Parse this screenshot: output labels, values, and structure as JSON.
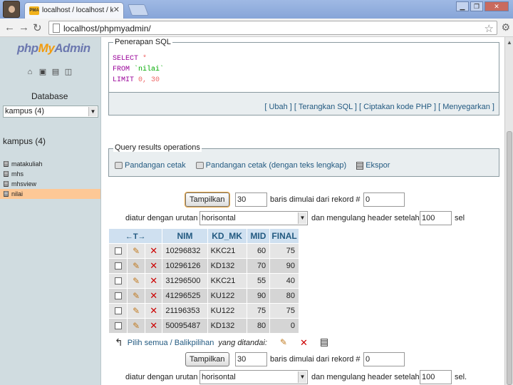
{
  "browser": {
    "tab_title": "localhost / localhost / kampus",
    "tab_favicon": "PMA",
    "tab_close": "✕",
    "url": "localhost/phpmyadmin/"
  },
  "sidebar": {
    "logo_php": "php",
    "logo_my": "My",
    "logo_admin": "Admin",
    "database_label": "Database",
    "database_select": "kampus (4)",
    "db_title": "kampus (4)",
    "tables": [
      {
        "label": "matakuliah",
        "active": false
      },
      {
        "label": "mhs",
        "active": false
      },
      {
        "label": "mhsview",
        "active": false
      },
      {
        "label": "nilai",
        "active": true
      }
    ]
  },
  "sql": {
    "legend": "Penerapan SQL",
    "select_kw": "SELECT",
    "select_rest": " *",
    "from_kw": "FROM",
    "from_rest": " `nilai`",
    "limit_kw": "LIMIT",
    "limit_rest": " 0, 30",
    "links": "[ Ubah ] [ Terangkan SQL ] [ Ciptakan kode PHP ] [ Menyegarkan ]"
  },
  "qro": {
    "legend": "Query results operations",
    "print": "Pandangan cetak",
    "print_full": "Pandangan cetak (dengan teks lengkap)",
    "export": "Ekspor"
  },
  "nav": {
    "show_button": "Tampilkan",
    "rows": "30",
    "rows_label": "baris dimulai dari rekord #",
    "start": "0",
    "mode_label": "diatur dengan urutan",
    "mode": "horisontal",
    "repeat_label": "dan mengulang header setelah",
    "repeat": "100",
    "cells": "sel"
  },
  "nav2": {
    "show_button": "Tampilkan",
    "rows": "30",
    "rows_label": "baris dimulai dari rekord #",
    "start": "0",
    "mode_label": "diatur dengan urutan",
    "mode": "horisontal",
    "repeat_label": "dan mengulang header setelah",
    "repeat": "100",
    "cells": "sel."
  },
  "table": {
    "arrows": "←T→",
    "columns": [
      "NIM",
      "KD_MK",
      "MID",
      "FINAL"
    ],
    "rows": [
      [
        "10296832",
        "KKC21",
        "60",
        "75"
      ],
      [
        "10296126",
        "KD132",
        "70",
        "90"
      ],
      [
        "31296500",
        "KKC21",
        "55",
        "40"
      ],
      [
        "41296525",
        "KU122",
        "90",
        "80"
      ],
      [
        "21196353",
        "KU122",
        "75",
        "75"
      ],
      [
        "50095487",
        "KD132",
        "80",
        "0"
      ]
    ]
  },
  "checkall": {
    "link": "Pilih semua / Balikpilihan",
    "suffix": "yang ditandai:"
  },
  "icons": {
    "edit": "✎",
    "delete": "✕"
  }
}
